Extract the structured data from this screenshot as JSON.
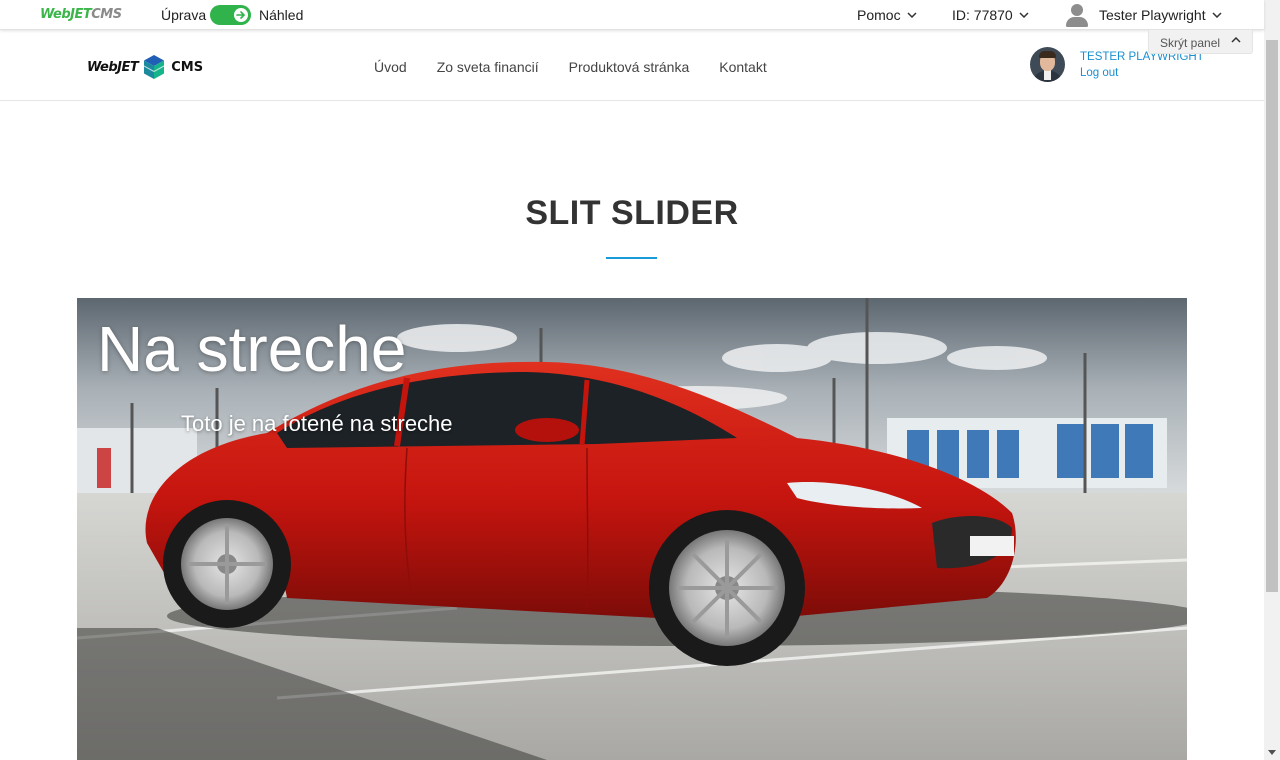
{
  "admin_bar": {
    "logo_part1": "WebJET",
    "logo_part2": "CMS",
    "edit_label": "Úprava",
    "view_label": "Náhled",
    "toggle_on": true,
    "help_label": "Pomoc",
    "id_label": "ID: 77870",
    "user_label": "Tester Playwright",
    "hide_panel_label": "Skrýt panel"
  },
  "site_header": {
    "logo_part1": "WebJET",
    "logo_part2": "CMS",
    "nav": [
      {
        "label": "Úvod"
      },
      {
        "label": "Zo sveta financií"
      },
      {
        "label": "Produktová stránka"
      },
      {
        "label": "Kontakt"
      }
    ],
    "profile_name": "TESTER PLAYWRIGHT",
    "logout_label": "Log out"
  },
  "content": {
    "page_title": "SLIT SLIDER",
    "slide_title": "Na streche",
    "slide_subtitle": "Toto je na fotené na streche"
  },
  "colors": {
    "accent_blue": "#1a9bd7",
    "toggle_green": "#2fb34a",
    "link_blue": "#1a8fd1",
    "car_red": "#c4140e"
  }
}
